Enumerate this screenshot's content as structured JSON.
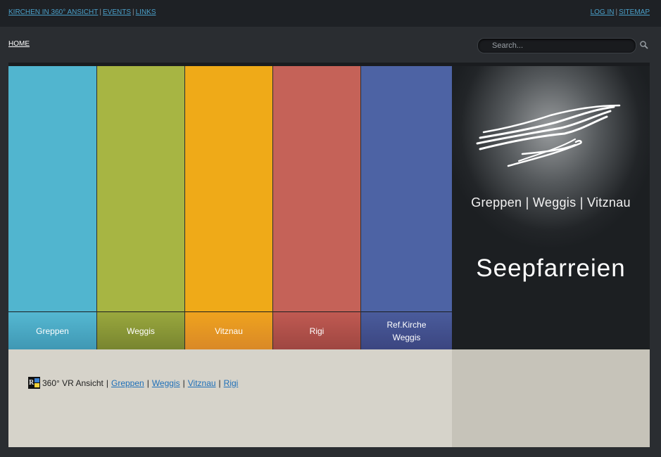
{
  "top_nav": {
    "left_links": [
      "KIRCHEN IN 360° ANSICHT",
      "EVENTS",
      "LINKS"
    ],
    "right_links": [
      "LOG IN",
      "SITEMAP"
    ],
    "separator": "|"
  },
  "nav": {
    "home": "HOME",
    "search_placeholder": "Search..."
  },
  "tiles": [
    {
      "label": "Greppen",
      "color": "#51b5cf",
      "label_bg": "#4aa3bf"
    },
    {
      "label": "Weggis",
      "color": "#a7b543",
      "label_bg": "#8e9a3a"
    },
    {
      "label": "Vitznau",
      "color": "#efaa18",
      "label_bg": "#e19523"
    },
    {
      "label": "Rigi",
      "color": "#c56258",
      "label_bg": "#b0504b"
    },
    {
      "label": "Ref.Kirche Weggis",
      "color": "#4d63a4",
      "label_bg": "#434f8e"
    }
  ],
  "logo": {
    "subtitle": "Greppen | Weggis | Vitznau",
    "title": "Seepfarreien"
  },
  "content": {
    "vr_label": "360° VR Ansicht",
    "separator": "|",
    "links": [
      "Greppen",
      "Weggis",
      "Vitznau",
      "Rigi"
    ]
  }
}
